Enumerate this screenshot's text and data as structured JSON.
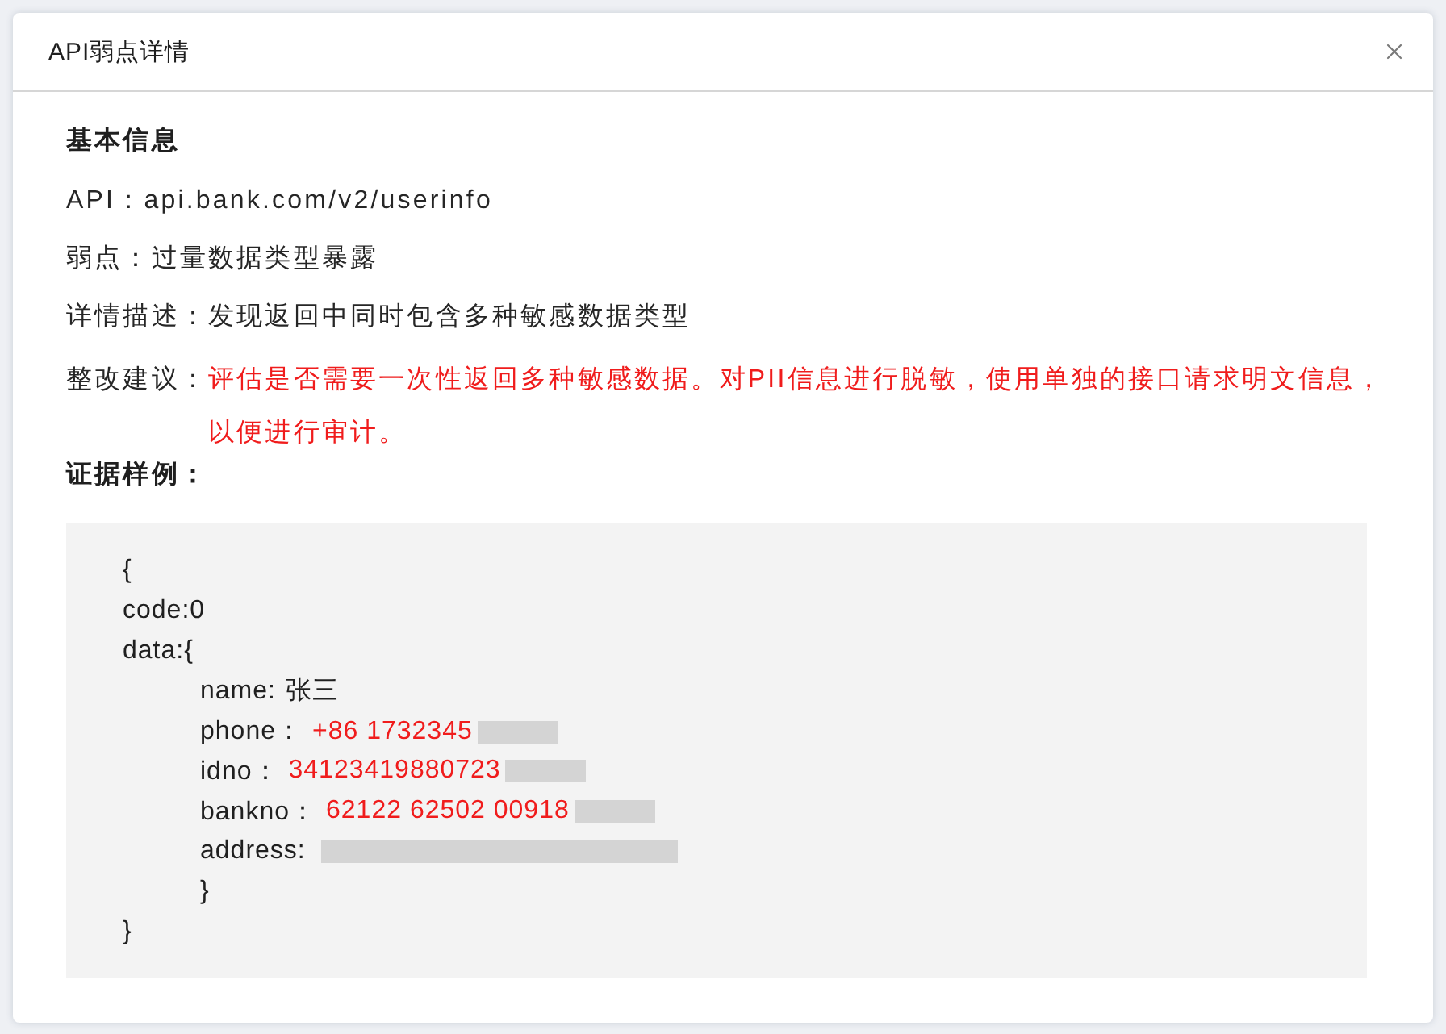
{
  "dialog": {
    "title": "API弱点详情"
  },
  "basic_info": {
    "heading": "基本信息",
    "fields": [
      {
        "label": "API：",
        "value": "api.bank.com/v2/userinfo",
        "kind": "normal"
      },
      {
        "label": "弱点：",
        "value": "过量数据类型暴露",
        "kind": "normal"
      },
      {
        "label": "详情描述：",
        "value": "发现返回中同时包含多种敏感数据类型",
        "kind": "normal"
      },
      {
        "label": "整改建议：",
        "value": "评估是否需要一次性返回多种敏感数据。对PII信息进行脱敏，使用单独的接口请求明文信息，以便进行审计。",
        "kind": "warning"
      }
    ]
  },
  "evidence": {
    "heading": "证据样例：",
    "lines": [
      {
        "kind": "text",
        "text": "{"
      },
      {
        "kind": "text",
        "text": "code:0"
      },
      {
        "kind": "text",
        "text": "data:{",
        "children": [
          {
            "kind": "pair",
            "key": "name:",
            "value": "张三",
            "sensitive": false
          },
          {
            "kind": "pair",
            "key": "phone：",
            "value": "+86 1732345",
            "sensitive": true,
            "redacted": true
          },
          {
            "kind": "pair",
            "key": "idno：",
            "value": "34123419880723",
            "sensitive": true,
            "redacted": true
          },
          {
            "kind": "pair",
            "key": "bankno：",
            "value": "62122 62502 00918",
            "sensitive": true,
            "redacted": true
          },
          {
            "kind": "pair",
            "key": "address:",
            "redacted": true
          },
          {
            "kind": "text",
            "text": "}"
          }
        ]
      },
      {
        "kind": "text",
        "text": "}"
      }
    ]
  }
}
